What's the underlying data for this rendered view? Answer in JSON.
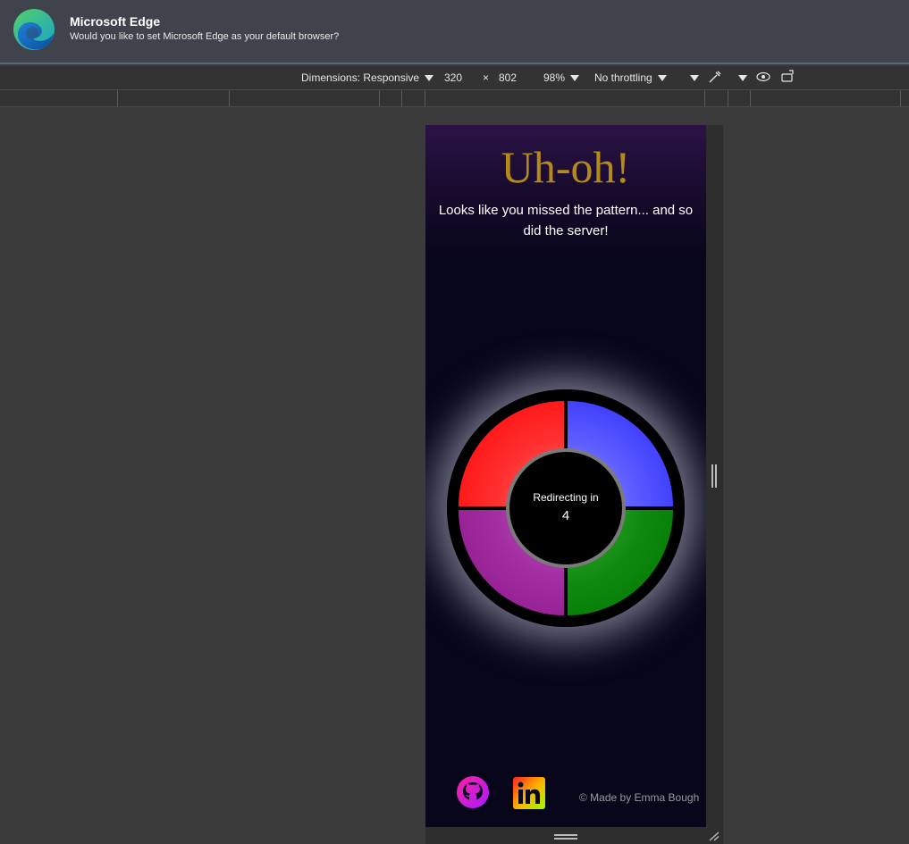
{
  "notification": {
    "title": "Microsoft Edge",
    "message": "Would you like to set Microsoft Edge as your default browser?",
    "icon": "edge-logo-icon"
  },
  "toolbar": {
    "dimensions_label": "Dimensions: Responsive",
    "width": "320",
    "times": "×",
    "height": "802",
    "zoom": "98%",
    "throttling": "No throttling"
  },
  "page": {
    "title": "Uh-oh!",
    "subtitle": "Looks like you missed the pattern... and so did the server!",
    "redirect_label": "Redirecting in",
    "countdown": "4",
    "credit": "© Made by Emma Bough",
    "colors": {
      "title": "#b58a1c",
      "red": "#ff0000",
      "blue": "#2323ff",
      "purple": "#8a148a",
      "green": "#007400",
      "background": "#07061a"
    },
    "links": [
      {
        "icon": "github-icon"
      },
      {
        "icon": "linkedin-icon"
      }
    ]
  }
}
